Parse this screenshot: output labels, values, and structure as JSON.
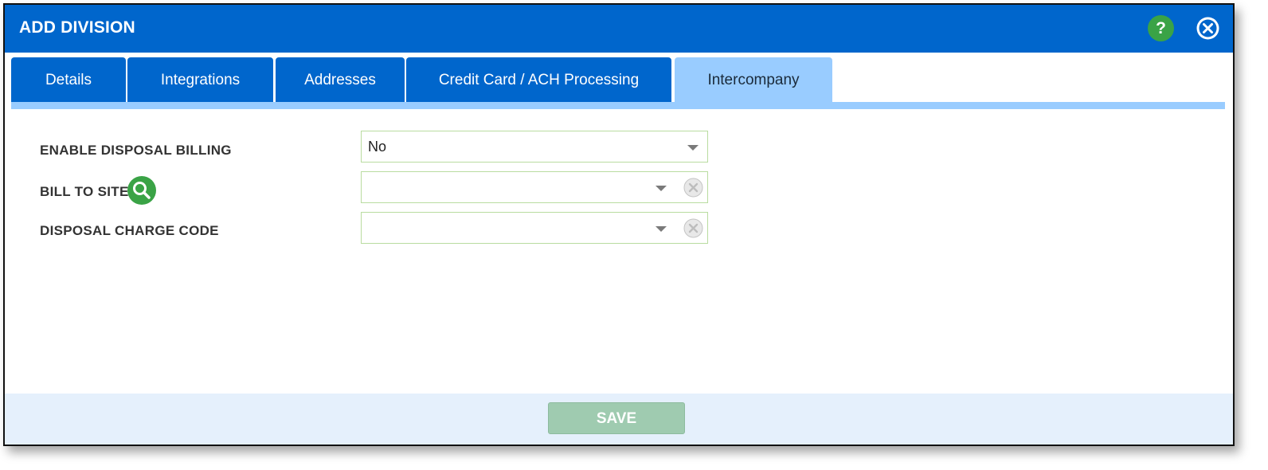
{
  "dialog": {
    "title": "ADD DIVISION",
    "help_icon": "?",
    "close_icon": "close-circle-icon"
  },
  "tabs": [
    {
      "label": "Details",
      "active": false
    },
    {
      "label": "Integrations",
      "active": false
    },
    {
      "label": "Addresses",
      "active": false
    },
    {
      "label": "Credit Card / ACH Processing",
      "active": false
    },
    {
      "label": "Intercompany",
      "active": true
    }
  ],
  "form": {
    "enable_disposal_billing": {
      "label": "ENABLE DISPOSAL BILLING",
      "value": "No"
    },
    "bill_to_site": {
      "label": "BILL TO SITE",
      "value": ""
    },
    "disposal_charge_code": {
      "label": "DISPOSAL CHARGE CODE",
      "value": ""
    }
  },
  "footer": {
    "save_label": "SAVE"
  },
  "colors": {
    "header_blue": "#0066cc",
    "active_tab": "#99ccff",
    "green_accent": "#3aa346",
    "save_disabled": "#9fcbb0",
    "footer_bg": "#e5f0fc"
  }
}
